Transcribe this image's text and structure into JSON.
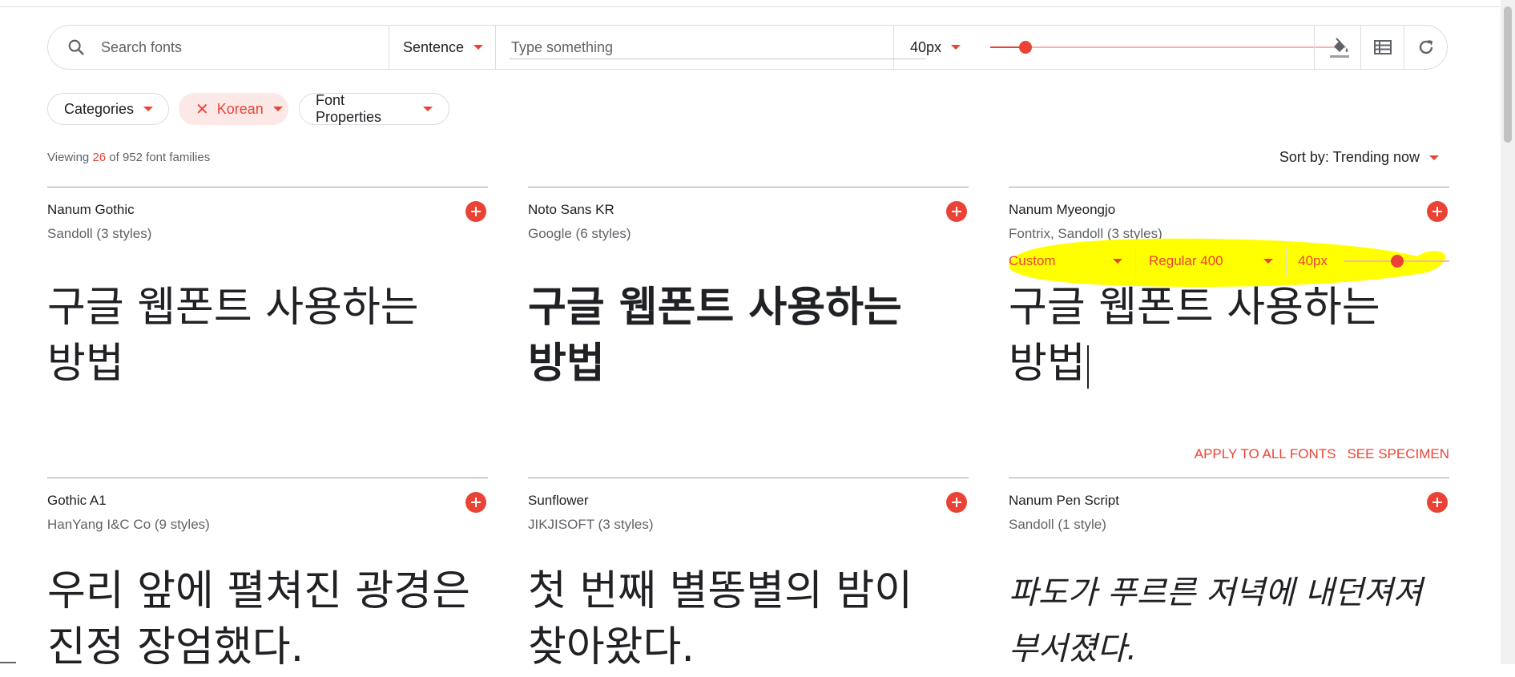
{
  "toolbar": {
    "search_placeholder": "Search fonts",
    "preview_mode": "Sentence",
    "type_placeholder": "Type something",
    "font_size": "40px",
    "font_size_slider_fraction": 0.1
  },
  "filters": {
    "chips": [
      {
        "label": "Categories",
        "active": false
      },
      {
        "label": "Korean",
        "active": true
      },
      {
        "label": "Font Properties",
        "active": false
      }
    ]
  },
  "summary": {
    "prefix": "Viewing",
    "shown": "26",
    "middle": "of 952 font families"
  },
  "sort": {
    "label": "Sort by: Trending now"
  },
  "cards": [
    {
      "name": "Nanum Gothic",
      "author": "Sandoll (3 styles)",
      "sample": "구글 웹폰트 사용하는 방법"
    },
    {
      "name": "Noto Sans KR",
      "author": "Google (6 styles)",
      "sample": "구글 웹폰트 사용하는 방법"
    },
    {
      "name": "Nanum Myeongjo",
      "author": "Fontrix, Sandoll (3 styles)",
      "sample": "구글 웹폰트 사용하는 방법"
    },
    {
      "name": "Gothic A1",
      "author": "HanYang I&C Co (9 styles)",
      "sample": "우리 앞에 펼쳐진 광경은 진정 장엄했다."
    },
    {
      "name": "Sunflower",
      "author": "JIKJISOFT (3 styles)",
      "sample": "첫 번째 별똥별의 밤이 찾아왔다."
    },
    {
      "name": "Nanum Pen Script",
      "author": "Sandoll (1 style)",
      "sample": "파도가 푸르른 저녁에 내던져져 부서졌다."
    }
  ],
  "customize": {
    "preset": "Custom",
    "weight": "Regular 400",
    "size": "40px",
    "size_slider_fraction": 0.5
  },
  "actions": {
    "apply_all": "APPLY TO ALL FONTS",
    "see_specimen": "SEE SPECIMEN"
  },
  "colors": {
    "accent": "#ea4335",
    "highlight": "#ffff00"
  }
}
